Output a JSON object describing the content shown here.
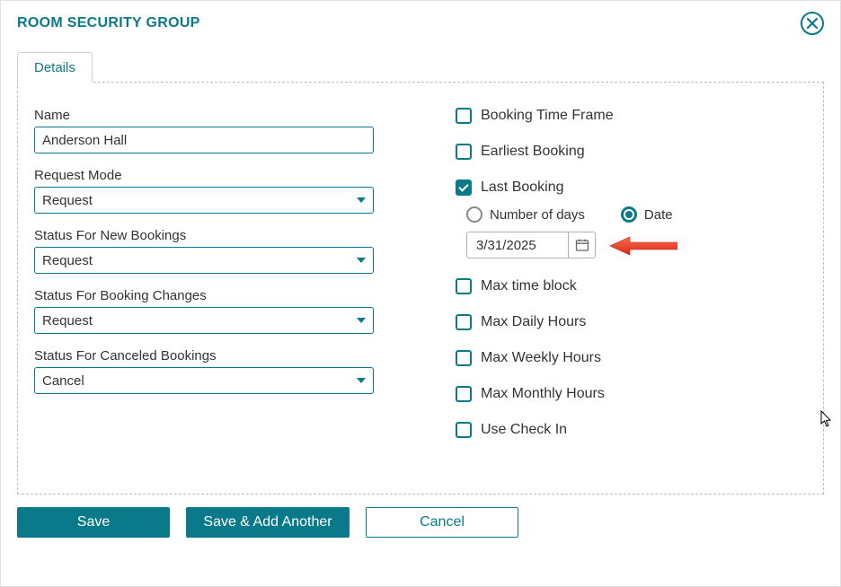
{
  "header": {
    "title": "ROOM SECURITY GROUP"
  },
  "tabs": {
    "details": "Details"
  },
  "fields": {
    "name": {
      "label": "Name",
      "value": "Anderson Hall"
    },
    "request_mode": {
      "label": "Request Mode",
      "value": "Request"
    },
    "status_new": {
      "label": "Status For New Bookings",
      "value": "Request"
    },
    "status_changes": {
      "label": "Status For Booking Changes",
      "value": "Request"
    },
    "status_canceled": {
      "label": "Status For Canceled Bookings",
      "value": "Cancel"
    }
  },
  "options": {
    "booking_time_frame": {
      "label": "Booking Time Frame",
      "checked": false
    },
    "earliest_booking": {
      "label": "Earliest Booking",
      "checked": false
    },
    "last_booking": {
      "label": "Last Booking",
      "checked": true,
      "sub": {
        "number_of_days": {
          "label": "Number of days",
          "selected": false
        },
        "date": {
          "label": "Date",
          "selected": true
        },
        "date_value": "3/31/2025"
      }
    },
    "max_time_block": {
      "label": "Max time block",
      "checked": false
    },
    "max_daily": {
      "label": "Max Daily Hours",
      "checked": false
    },
    "max_weekly": {
      "label": "Max Weekly Hours",
      "checked": false
    },
    "max_monthly": {
      "label": "Max Monthly Hours",
      "checked": false
    },
    "use_check_in": {
      "label": "Use Check In",
      "checked": false
    }
  },
  "footer": {
    "save": "Save",
    "save_add": "Save & Add Another",
    "cancel": "Cancel"
  }
}
